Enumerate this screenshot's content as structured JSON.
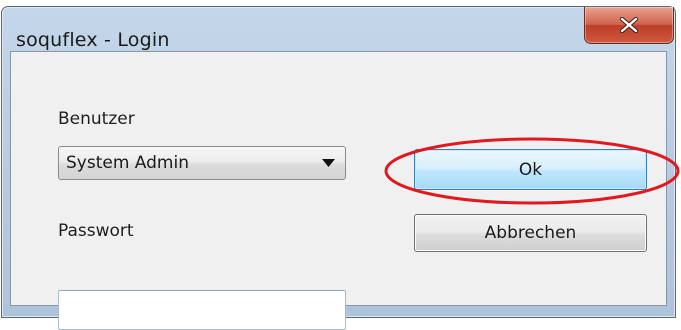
{
  "window": {
    "title": "soquflex - Login",
    "close_icon": "close-icon"
  },
  "form": {
    "user_label": "Benutzer",
    "user_value": "System Admin",
    "password_label": "Passwort",
    "password_value": "",
    "dropdown_icon": "chevron-down-icon"
  },
  "buttons": {
    "ok_label": "Ok",
    "cancel_label": "Abbrechen"
  },
  "annotation": {
    "highlight_color": "#e0191f"
  },
  "colors": {
    "ok_accent": "#3c7fb1",
    "close_button": "#c9452f"
  }
}
